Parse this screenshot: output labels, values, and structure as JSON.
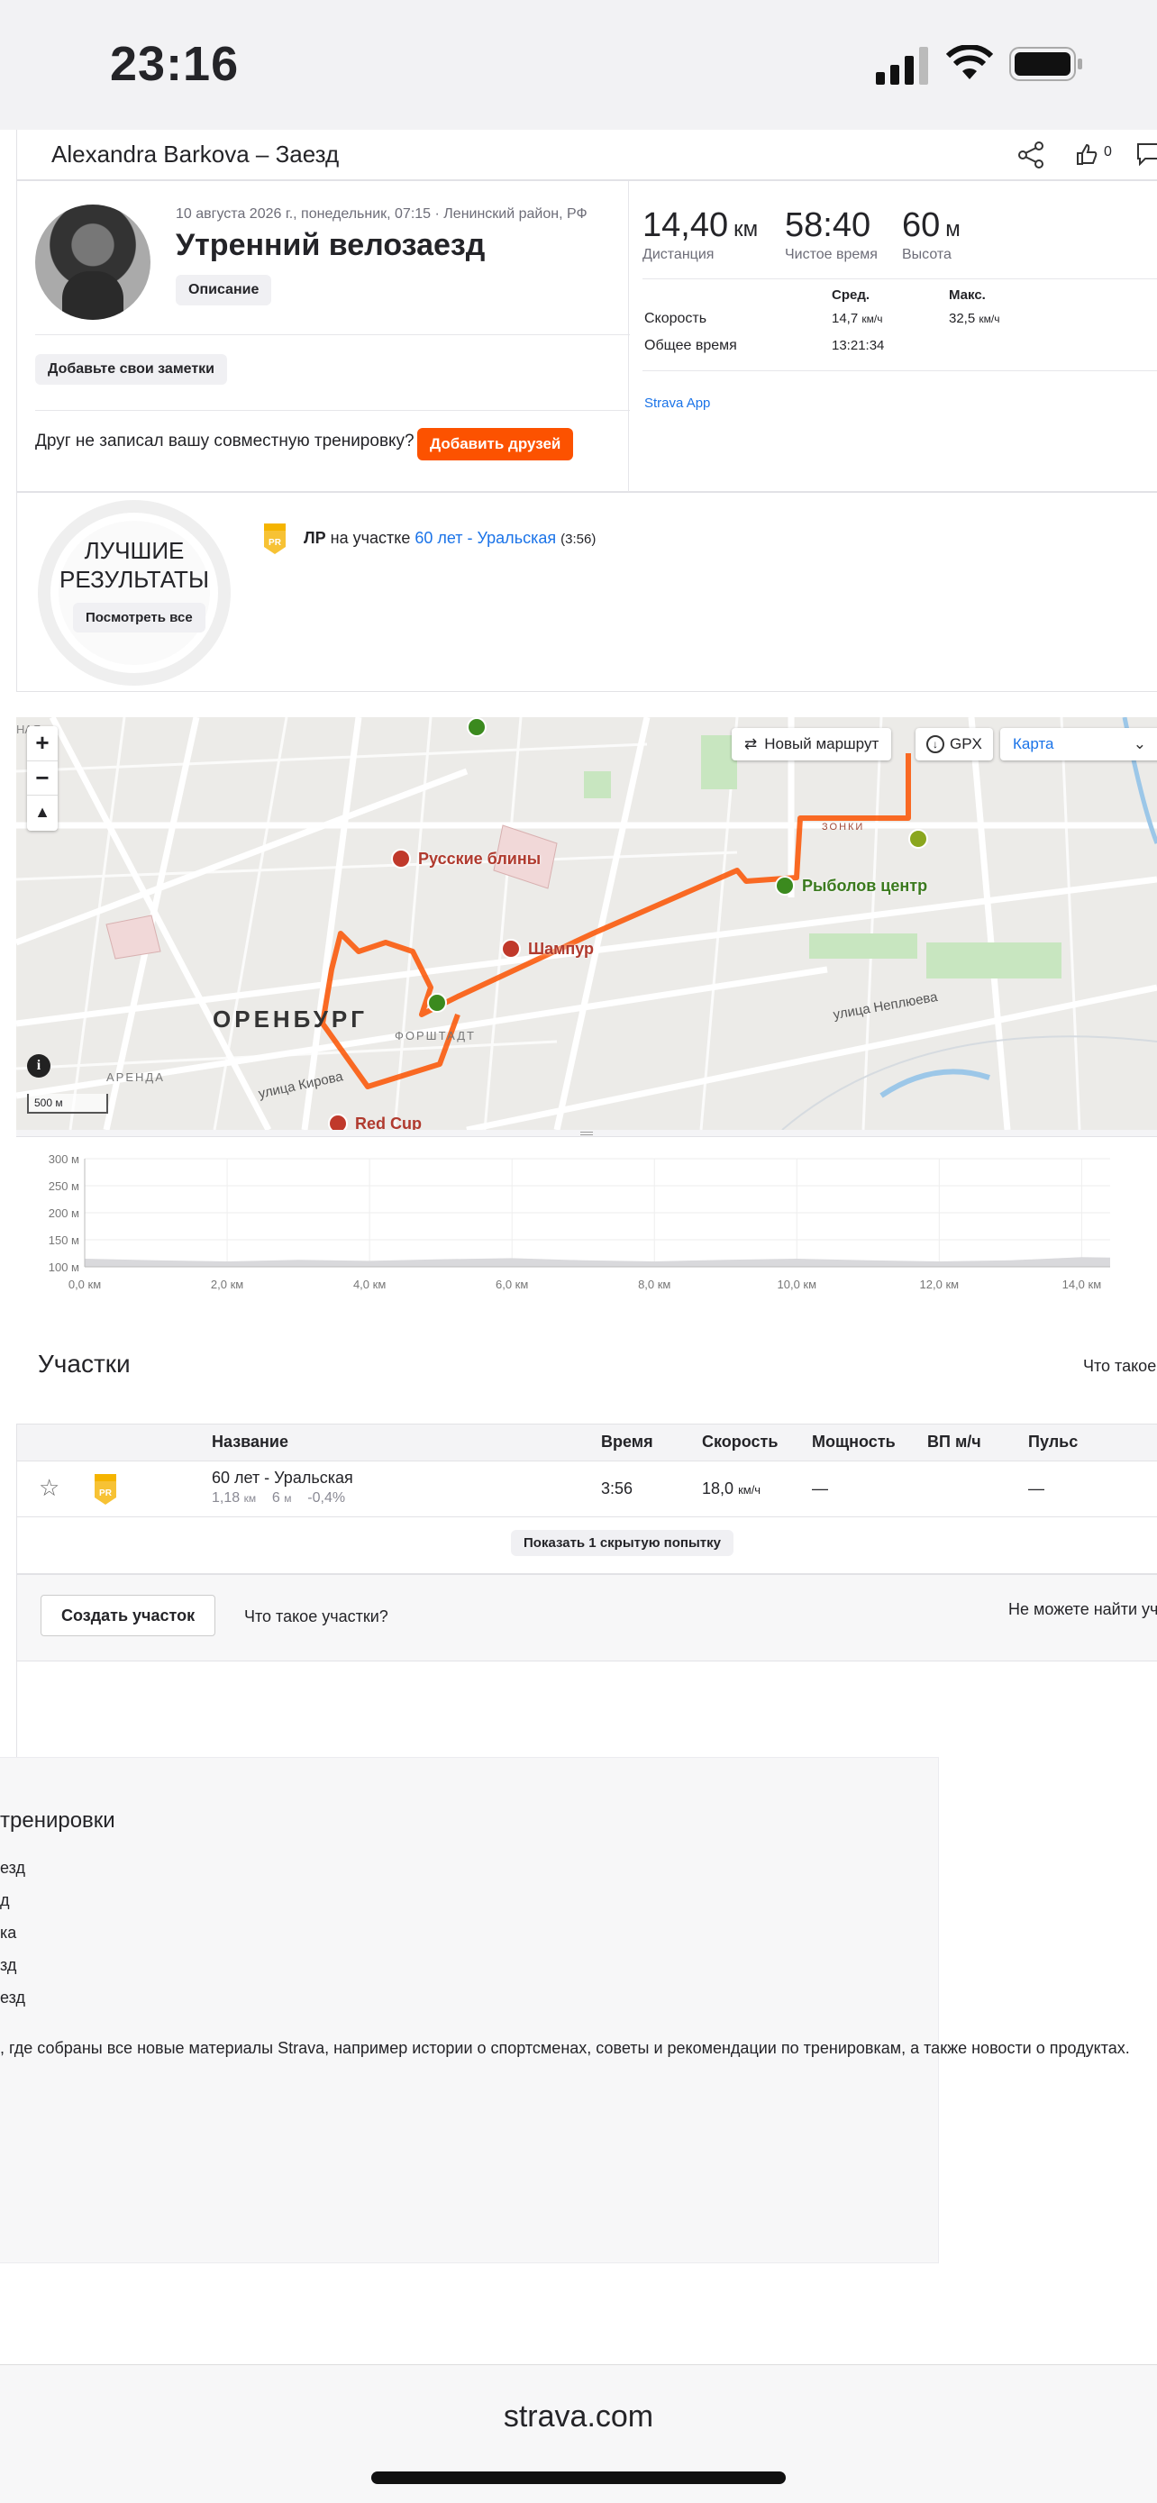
{
  "status_bar": {
    "time": "23:16"
  },
  "header": {
    "title": "Alexandra Barkova – Заезд",
    "kudos_count": "0"
  },
  "activity": {
    "meta": "10 августа 2026 г., понедельник, 07:15 · Ленинский район, РФ",
    "title": "Утренний велозаезд",
    "description_button": "Описание",
    "notes_button": "Добавьте свои заметки",
    "friend_prompt": "Друг не записал вашу совместную тренировку?",
    "add_friends_button": "Добавить друзей"
  },
  "stats": {
    "distance": {
      "value": "14,40",
      "unit": "км",
      "label": "Дистанция"
    },
    "moving_time": {
      "value": "58:40",
      "label": "Чистое время"
    },
    "elevation": {
      "value": "60",
      "unit": "м",
      "label": "Высота"
    },
    "col_avg": "Сред.",
    "col_max": "Макс.",
    "speed_label": "Скорость",
    "speed_avg": "14,7",
    "speed_max": "32,5",
    "speed_unit": "км/ч",
    "elapsed_label": "Общее время",
    "elapsed_value": "13:21:34",
    "device": "Strava App"
  },
  "best": {
    "badge_line1": "ЛУЧШИЕ",
    "badge_line2": "РЕЗУЛЬТАТЫ",
    "view_all": "Посмотреть все",
    "pr_label": "ЛР",
    "pr_on": "на участке",
    "pr_segment": "60 лет - Уральская",
    "pr_time": "(3:56)"
  },
  "map": {
    "new_route": "Новый маршрут",
    "gpx": "GPX",
    "map_type": "Карта",
    "zoom_in": "+",
    "zoom_out": "−",
    "scale": "500 м",
    "labels": {
      "city": "ОРЕНБУРГ",
      "poi1": "Русские блины",
      "poi2": "Шампур",
      "poi3": "Рыболов центр",
      "poi4": "Red Cup",
      "district1": "ФОРШТАДТ",
      "district2": "АРЕНДА",
      "street1": "улица Кирова",
      "street2": "улица Неплюева",
      "top_left": "НАЯ",
      "zone": "ЗОНКИ"
    }
  },
  "chart_data": {
    "type": "area",
    "title": "",
    "y_ticks": [
      "300 м",
      "250 м",
      "200 м",
      "150 м",
      "100 м"
    ],
    "x_ticks": [
      "0,0 км",
      "2,0 км",
      "4,0 км",
      "6,0 км",
      "8,0 км",
      "10,0 км",
      "12,0 км",
      "14,0 км"
    ],
    "ylim": [
      100,
      300
    ],
    "xlim": [
      0,
      14.4
    ],
    "x": [
      0,
      1,
      2,
      3,
      4,
      5,
      6,
      7,
      8,
      9,
      10,
      11,
      12,
      13,
      14,
      14.4
    ],
    "y": [
      115,
      112,
      110,
      113,
      111,
      114,
      116,
      112,
      110,
      113,
      115,
      112,
      110,
      112,
      118,
      117
    ],
    "grid": true
  },
  "segments": {
    "title": "Участки",
    "what_link": "Что такое",
    "columns": [
      "Название",
      "Время",
      "Скорость",
      "Мощность",
      "ВП м/ч",
      "Пульс"
    ],
    "rows": [
      {
        "name": "60 лет - Уральская",
        "dist": "1,18",
        "dist_unit": "км",
        "elev": "6",
        "elev_unit": "м",
        "grade": "-0,4%",
        "time": "3:56",
        "speed": "18,0",
        "speed_unit": "км/ч",
        "power": "—",
        "hr": "—"
      }
    ],
    "show_hidden": "Показать 1 скрытую попытку",
    "create_button": "Создать участок",
    "what_are": "Что такое участки?",
    "cant_find": "Не можете найти уч"
  },
  "footer_box": {
    "heading": "тренировки",
    "items": [
      "езд",
      "д",
      "ка",
      "зд",
      "езд"
    ],
    "text": ", где собраны все новые материалы Strava, например истории о спортсменах, советы и рекомендации по тренировкам, а также новости о продуктах."
  },
  "bottom_bar": {
    "url": "strava.com"
  }
}
